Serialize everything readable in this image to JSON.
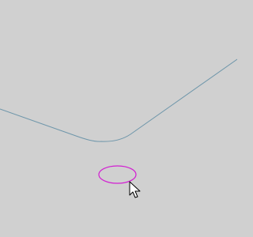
{
  "canvas": {
    "background_color": "#d0d0d0"
  },
  "curve": {
    "stroke_color": "#6e96aa"
  },
  "ellipse": {
    "stroke_color": "#d21ed2"
  },
  "cursor": {
    "icon": "mouse-pointer-icon",
    "fill_color": "#ffffff",
    "outline_color": "#000000"
  }
}
